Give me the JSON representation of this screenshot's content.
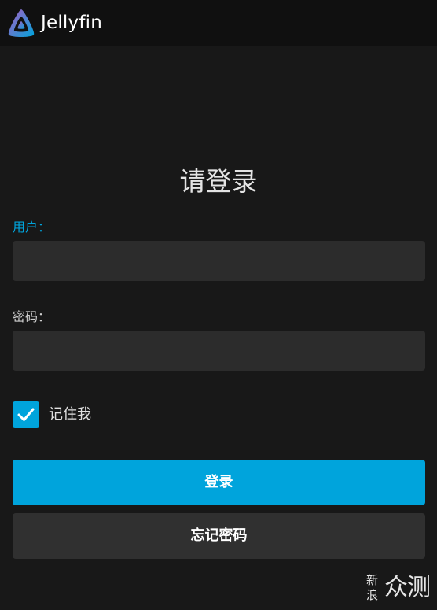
{
  "header": {
    "app_name": "Jellyfin",
    "logo_icon": "jellyfin-logo-icon"
  },
  "login": {
    "title": "请登录",
    "user_label": "用户：",
    "user_value": "",
    "password_label": "密码：",
    "password_value": "",
    "remember_me_label": "记住我",
    "remember_me_checked": true,
    "login_button": "登录",
    "forgot_password_button": "忘记密码"
  },
  "watermark": {
    "left_text": "新浪",
    "right_text": "众测"
  },
  "colors": {
    "accent": "#00a4dc",
    "background": "#181818",
    "header": "#101010",
    "input_bg": "#2c2c2c",
    "secondary_button": "#303030"
  }
}
